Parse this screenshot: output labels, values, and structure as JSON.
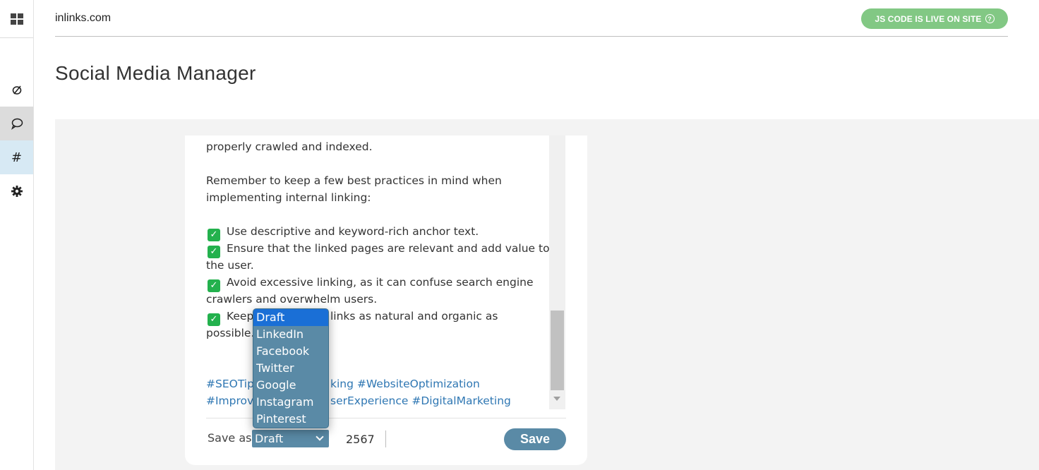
{
  "header": {
    "site": "inlinks.com",
    "badge": "JS CODE IS LIVE ON SITE",
    "badge_icon": "help-circle-icon"
  },
  "page": {
    "title": "Social Media Manager"
  },
  "sidebar": {
    "items": [
      {
        "name": "dashboard",
        "icon": "grid-icon"
      },
      {
        "name": "links",
        "icon": "link-icon"
      },
      {
        "name": "social",
        "icon": "chat-bubble-icon"
      },
      {
        "name": "hashtags",
        "icon": "hash-icon",
        "glyph": "#"
      },
      {
        "name": "settings",
        "icon": "gear-icon"
      }
    ]
  },
  "post": {
    "lines": [
      "properly crawled and indexed.",
      "Remember to keep a few best practices in mind when",
      "implementing internal linking:",
      "Use descriptive and keyword-rich anchor text.",
      "Ensure that the linked pages are relevant and add value to",
      "the user.",
      "Avoid excessive linking, as it can confuse search engine",
      "crawlers and overwhelm users.",
      "Keep",
      "links as natural and organic as",
      "possible."
    ],
    "hashtags_line1_a": "#SEOTip",
    "hashtags_line1_b": "king #WebsiteOptimization",
    "hashtags_line2_a": "#Improv",
    "hashtags_line2_b": "serExperience #DigitalMarketing"
  },
  "footer": {
    "save_as_label": "Save as",
    "selected_option": "Draft",
    "char_count": "2567",
    "save_label": "Save"
  },
  "dropdown": {
    "options": [
      "Draft",
      "LinkedIn",
      "Facebook",
      "Twitter",
      "Google",
      "Instagram",
      "Pinterest"
    ],
    "selected": "Draft"
  },
  "colors": {
    "accent": "#5a8aa6",
    "badge": "#82c884",
    "hashtag": "#2f77b3",
    "check": "#23b14d",
    "highlight": "#1a6fd6"
  }
}
